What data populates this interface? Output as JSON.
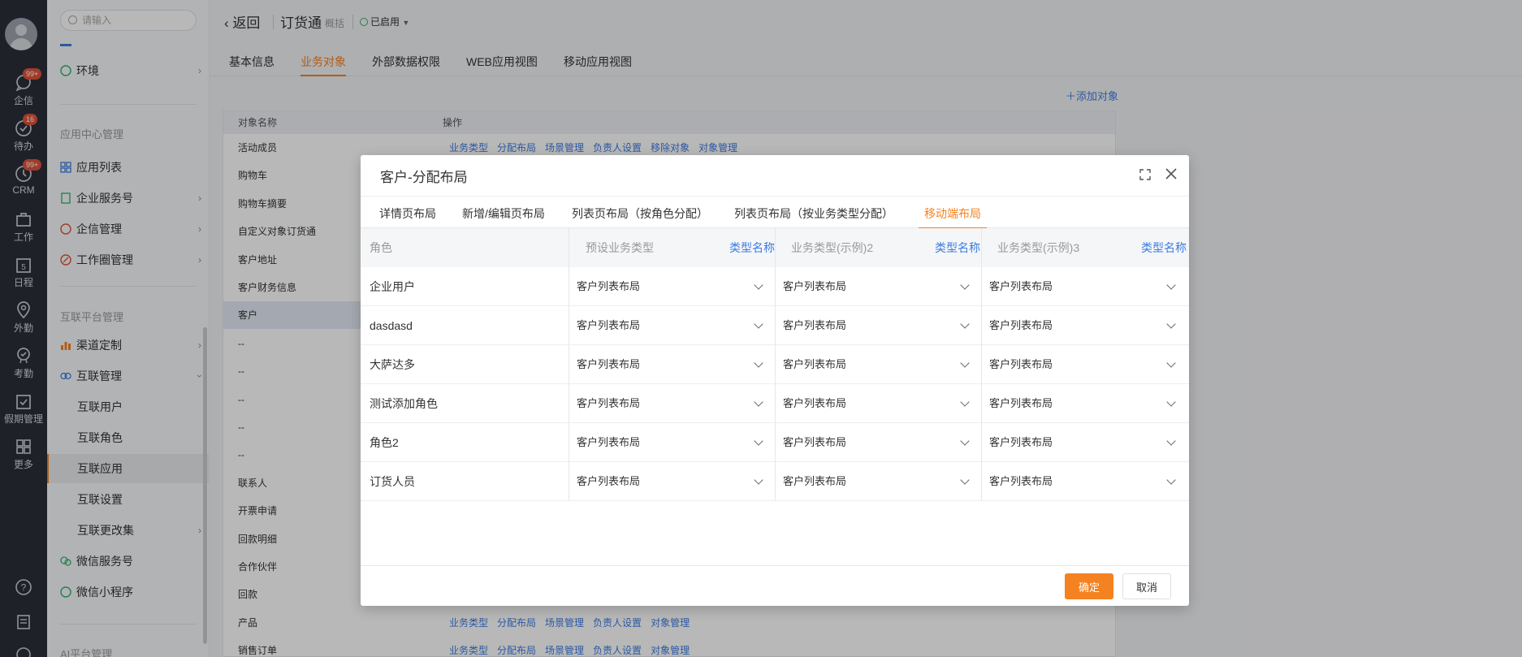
{
  "rail": {
    "items": [
      {
        "label": "企信",
        "badge": "99+",
        "icon": "chat-icon"
      },
      {
        "label": "待办",
        "badge": "16",
        "icon": "check-circle-icon"
      },
      {
        "label": "CRM",
        "badge": "99+",
        "icon": "clock-icon"
      },
      {
        "label": "工作",
        "icon": "briefcase-icon"
      },
      {
        "label": "日程",
        "icon": "calendar-icon",
        "day": "5"
      },
      {
        "label": "外勤",
        "icon": "location-icon"
      },
      {
        "label": "考勤",
        "icon": "attendance-icon"
      },
      {
        "label": "假期管理",
        "icon": "leave-icon"
      },
      {
        "label": "更多",
        "icon": "grid-icon"
      }
    ]
  },
  "sidebar": {
    "search_placeholder": "请输入",
    "env": "环境",
    "group_app_center": "应用中心管理",
    "app_list": "应用列表",
    "enterprise_service": "企业服务号",
    "qixin_manage": "企信管理",
    "workcircle_manage": "工作圈管理",
    "group_interconnect": "互联平台管理",
    "channel_custom": "渠道定制",
    "interconnect_manage": "互联管理",
    "sub_items": [
      "互联用户",
      "互联角色",
      "互联应用",
      "互联设置",
      "互联更改集"
    ],
    "wechat_service": "微信服务号",
    "wechat_mini": "微信小程序",
    "group_ai": "AI平台管理"
  },
  "header": {
    "back": "返回",
    "app_title": "订货通",
    "summary": "概括",
    "status": "已启用"
  },
  "main_tabs": [
    "基本信息",
    "业务对象",
    "外部数据权限",
    "WEB应用视图",
    "移动应用视图"
  ],
  "add_object": "添加对象",
  "object_table": {
    "col_name": "对象名称",
    "col_ops": "操作",
    "rows": [
      {
        "name": "活动成员",
        "ops": [
          "业务类型",
          "分配布局",
          "场景管理",
          "负责人设置",
          "移除对象",
          "对象管理"
        ]
      },
      {
        "name": "购物车",
        "ops": []
      },
      {
        "name": "购物车摘要",
        "ops": []
      },
      {
        "name": "自定义对象订货通",
        "ops": []
      },
      {
        "name": "客户地址",
        "ops": []
      },
      {
        "name": "客户财务信息",
        "ops": []
      },
      {
        "name": "客户",
        "ops": []
      },
      {
        "name": "--",
        "ops": []
      },
      {
        "name": "--",
        "ops": []
      },
      {
        "name": "--",
        "ops": []
      },
      {
        "name": "--",
        "ops": []
      },
      {
        "name": "--",
        "ops": []
      },
      {
        "name": "联系人",
        "ops": []
      },
      {
        "name": "开票申请",
        "ops": []
      },
      {
        "name": "回款明细",
        "ops": []
      },
      {
        "name": "合作伙伴",
        "ops": []
      },
      {
        "name": "回款",
        "ops": []
      },
      {
        "name": "产品",
        "ops": [
          "业务类型",
          "分配布局",
          "场景管理",
          "负责人设置",
          "对象管理"
        ]
      },
      {
        "name": "销售订单",
        "ops": [
          "业务类型",
          "分配布局",
          "场景管理",
          "负责人设置",
          "对象管理"
        ]
      }
    ]
  },
  "dialog": {
    "title": "客户-分配布局",
    "tabs": [
      "详情页布局",
      "新增/编辑页布局",
      "列表页布局（按角色分配）",
      "列表页布局（按业务类型分配）",
      "移动端布局"
    ],
    "active_tab": 4,
    "col_role": "角色",
    "columns": [
      {
        "name": "预设业务类型",
        "link": "类型名称"
      },
      {
        "name": "业务类型(示例)2",
        "link": "类型名称"
      },
      {
        "name": "业务类型(示例)3",
        "link": "类型名称"
      }
    ],
    "rows": [
      {
        "role": "企业用户",
        "values": [
          "客户列表布局",
          "客户列表布局",
          "客户列表布局"
        ]
      },
      {
        "role": "dasdasd",
        "values": [
          "客户列表布局",
          "客户列表布局",
          "客户列表布局"
        ]
      },
      {
        "role": "大萨达多",
        "values": [
          "客户列表布局",
          "客户列表布局",
          "客户列表布局"
        ]
      },
      {
        "role": "测试添加角色",
        "values": [
          "客户列表布局",
          "客户列表布局",
          "客户列表布局"
        ]
      },
      {
        "role": "角色2",
        "values": [
          "客户列表布局",
          "客户列表布局",
          "客户列表布局"
        ]
      },
      {
        "role": "订货人员",
        "values": [
          "客户列表布局",
          "客户列表布局",
          "客户列表布局"
        ]
      }
    ],
    "ok": "确定",
    "cancel": "取消"
  },
  "colors": {
    "accent": "#f58220",
    "link": "#3d7ce1",
    "rail": "#2b2f3a"
  }
}
